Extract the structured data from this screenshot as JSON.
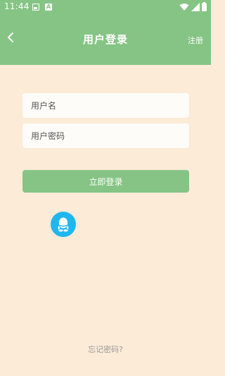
{
  "status_bar": {
    "time": "11:44",
    "icons": [
      "image-notification-icon",
      "a-notification-icon",
      "wifi-icon",
      "signal-icon",
      "battery-icon"
    ],
    "notification_letter": "A"
  },
  "nav": {
    "title": "用户登录",
    "back_icon": "chevron-left-icon",
    "register_label": "注册"
  },
  "form": {
    "username_placeholder": "用户名",
    "password_placeholder": "用户密码",
    "login_label": "立即登录"
  },
  "social": {
    "qq_icon": "qq-icon"
  },
  "footer": {
    "forgot_label": "忘记密码?"
  },
  "colors": {
    "header": "#86c485",
    "background": "#fbebd7",
    "input_bg": "#fefcf8",
    "qq_blue": "#1eb7f0"
  }
}
